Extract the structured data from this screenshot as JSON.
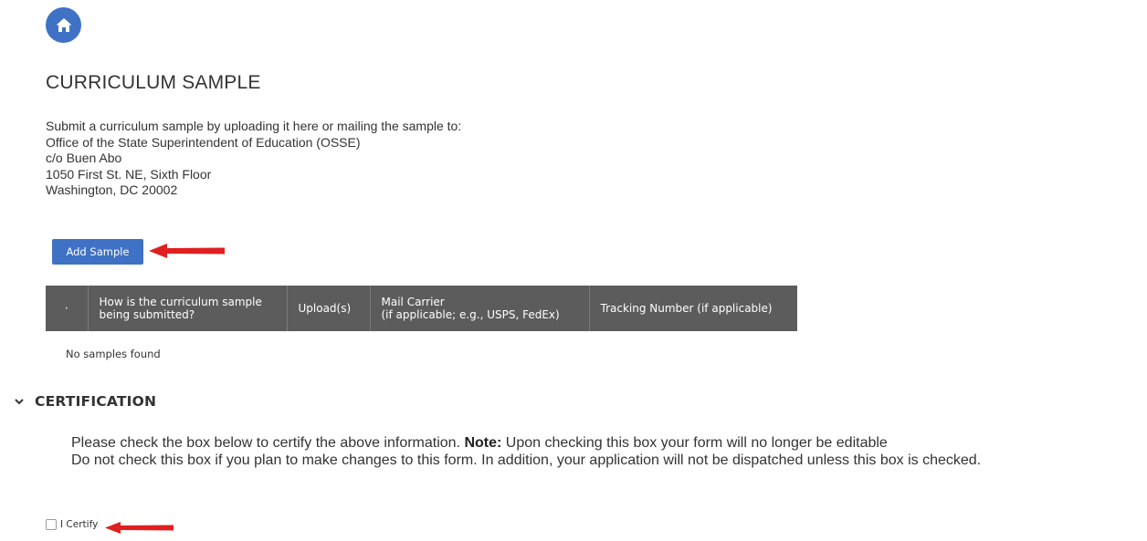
{
  "page": {
    "title": "CURRICULUM SAMPLE",
    "intro_lines": [
      "Submit a curriculum sample by uploading it here or mailing the sample to:",
      "Office of the State Superintendent of Education (OSSE)",
      "c/o Buen Abo",
      "1050 First St. NE, Sixth Floor",
      "Washington, DC 20002"
    ]
  },
  "nav": {
    "home_icon": "home-icon",
    "accent_color": "#3f72c4"
  },
  "samples": {
    "add_label": "Add Sample",
    "columns": [
      {
        "line1": "·",
        "line2": ""
      },
      {
        "line1": "How is the curriculum sample",
        "line2": "being submitted?"
      },
      {
        "line1": "Upload(s)",
        "line2": ""
      },
      {
        "line1": "Mail Carrier",
        "line2": "(if applicable; e.g., USPS, FedEx)"
      },
      {
        "line1": "Tracking Number (if applicable)",
        "line2": ""
      }
    ],
    "empty_message": "No samples found"
  },
  "certification": {
    "title": "CERTIFICATION",
    "text_before_note": "Please check the box below to certify the above information. ",
    "note_label": "Note:",
    "text_after_note": " Upon checking this box your form will no longer be editable",
    "text_line2": "Do not check this box if you plan to make changes to this form. In addition, your application will not be dispatched unless this box is checked.",
    "checkbox_label": "I Certify",
    "checked": false
  },
  "annotations": {
    "arrow_color": "#e02020"
  }
}
